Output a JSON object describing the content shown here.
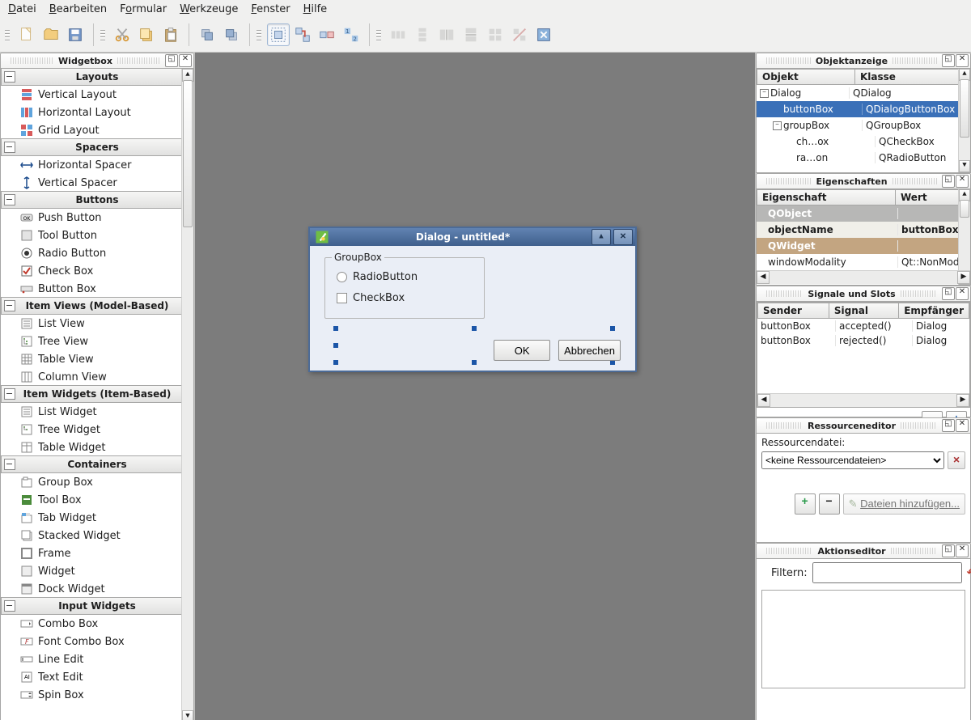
{
  "menu": [
    "Datei",
    "Bearbeiten",
    "Formular",
    "Werkzeuge",
    "Fenster",
    "Hilfe"
  ],
  "widgetbox": {
    "title": "Widgetbox",
    "groups": [
      {
        "label": "Layouts",
        "items": [
          "Vertical Layout",
          "Horizontal Layout",
          "Grid Layout"
        ]
      },
      {
        "label": "Spacers",
        "items": [
          "Horizontal Spacer",
          "Vertical Spacer"
        ]
      },
      {
        "label": "Buttons",
        "items": [
          "Push Button",
          "Tool Button",
          "Radio Button",
          "Check Box",
          "Button Box"
        ]
      },
      {
        "label": "Item Views (Model-Based)",
        "items": [
          "List View",
          "Tree View",
          "Table View",
          "Column View"
        ]
      },
      {
        "label": "Item Widgets (Item-Based)",
        "items": [
          "List Widget",
          "Tree Widget",
          "Table Widget"
        ]
      },
      {
        "label": "Containers",
        "items": [
          "Group Box",
          "Tool Box",
          "Tab Widget",
          "Stacked Widget",
          "Frame",
          "Widget",
          "Dock Widget"
        ]
      },
      {
        "label": "Input Widgets",
        "items": [
          "Combo Box",
          "Font Combo Box",
          "Line Edit",
          "Text Edit",
          "Spin Box"
        ]
      }
    ]
  },
  "dialog": {
    "title": "Dialog - untitled*",
    "group": "GroupBox",
    "radio": "RadioButton",
    "check": "CheckBox",
    "ok": "OK",
    "cancel": "Abbrechen"
  },
  "objectInspector": {
    "title": "Objektanzeige",
    "headers": [
      "Objekt",
      "Klasse"
    ],
    "rows": [
      {
        "indent": 0,
        "expand": "-",
        "name": "Dialog",
        "klass": "QDialog",
        "sel": false
      },
      {
        "indent": 1,
        "expand": "",
        "name": "buttonBox",
        "klass": "QDialogButtonBox",
        "sel": true
      },
      {
        "indent": 1,
        "expand": "-",
        "name": "groupBox",
        "klass": "QGroupBox",
        "sel": false
      },
      {
        "indent": 2,
        "expand": "",
        "name": "ch…ox",
        "klass": "QCheckBox",
        "sel": false
      },
      {
        "indent": 2,
        "expand": "",
        "name": "ra…on",
        "klass": "QRadioButton",
        "sel": false
      }
    ]
  },
  "props": {
    "title": "Eigenschaften",
    "headers": [
      "Eigenschaft",
      "Wert"
    ],
    "rows": [
      {
        "type": "groupQ",
        "label": "QObject"
      },
      {
        "type": "name",
        "label": "objectName",
        "value": "buttonBox"
      },
      {
        "type": "groupW",
        "label": "QWidget"
      },
      {
        "type": "plain",
        "label": "windowModality",
        "value": "Qt::NonModal"
      }
    ]
  },
  "signals": {
    "title": "Signale und Slots",
    "headers": [
      "Sender",
      "Signal",
      "Empfänger"
    ],
    "rows": [
      {
        "s": "buttonBox",
        "sig": "accepted()",
        "r": "Dialog"
      },
      {
        "s": "buttonBox",
        "sig": "rejected()",
        "r": "Dialog"
      }
    ]
  },
  "res": {
    "title": "Ressourceneditor",
    "label": "Ressourcendatei:",
    "select": "<keine Ressourcendateien>",
    "addFiles": "Dateien hinzufügen..."
  },
  "actions": {
    "title": "Aktionseditor",
    "filter": "Filtern:"
  }
}
